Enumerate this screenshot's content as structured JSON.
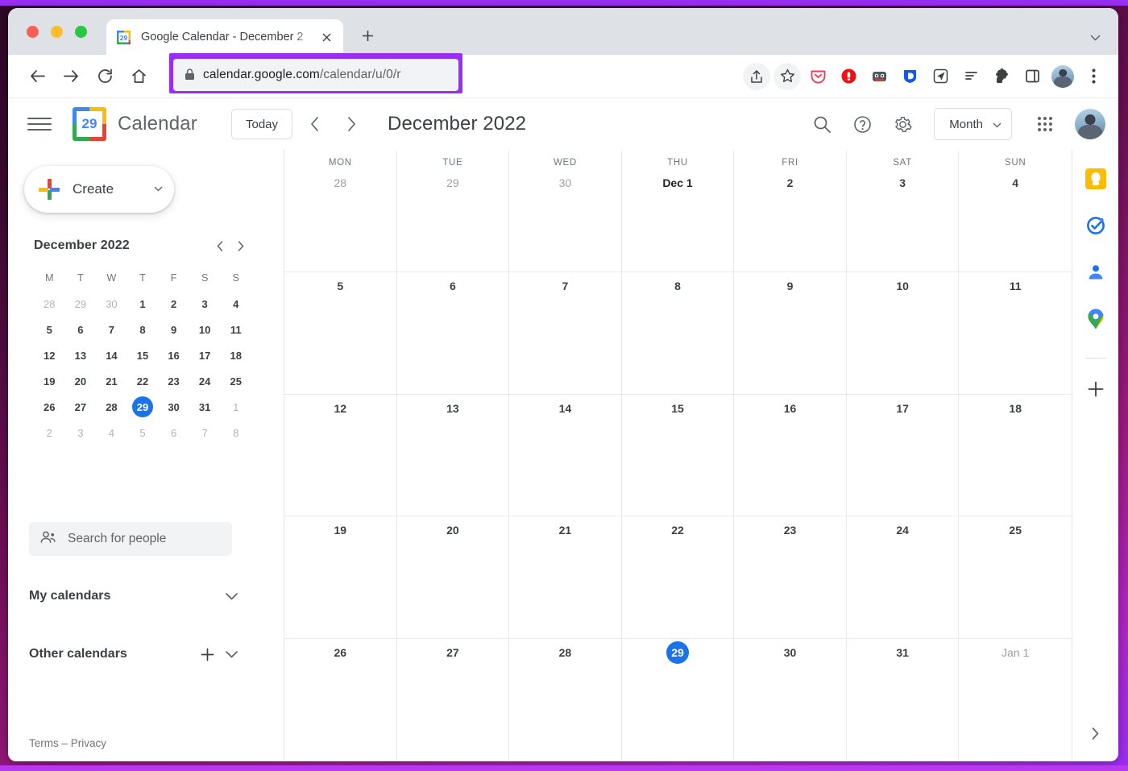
{
  "browser": {
    "tab": {
      "title": "Google Calendar - December 2",
      "favicon_label": "29",
      "close_icon": "close-icon"
    },
    "new_tab_label": "+",
    "tabstrip_chevron": "⌄",
    "omnibox": {
      "domain": "calendar.google.com",
      "path": "/calendar/u/0/r",
      "lock_icon": "lock-icon",
      "highlight_color": "#9b2ef5"
    },
    "nav": {
      "back": "back-arrow",
      "forward": "forward-arrow",
      "reload": "reload-icon",
      "home": "home-icon"
    },
    "extensions": [
      "share-icon",
      "bookmark-star-icon",
      "pocket-extension-icon",
      "adblock-extension-icon",
      "avatar-extension-icon",
      "dashlane-extension-icon",
      "paperplane-extension-icon",
      "reading-list-icon",
      "puzzle-extensions-icon",
      "side-panel-icon",
      "profile-avatar",
      "chrome-menu-icon"
    ]
  },
  "app": {
    "menu_label": "main-menu",
    "logo_label": "29",
    "title": "Calendar",
    "today_label": "Today",
    "prev_label": "‹",
    "next_label": "›",
    "period": "December 2022",
    "search_label": "search-icon",
    "help_label": "help-icon",
    "settings_label": "settings-icon",
    "view_label": "Month",
    "view_caret": "▾",
    "apps_label": "google-apps-grid",
    "avatar_label": "account-avatar"
  },
  "sidebar": {
    "create_label": "Create",
    "create_caret": "▾",
    "mini_calendar": {
      "title": "December 2022",
      "prev": "‹",
      "next": "›",
      "dow": [
        "M",
        "T",
        "W",
        "T",
        "F",
        "S",
        "S"
      ],
      "weeks": [
        [
          {
            "d": "28",
            "m": true
          },
          {
            "d": "29",
            "m": true
          },
          {
            "d": "30",
            "m": true
          },
          {
            "d": "1"
          },
          {
            "d": "2"
          },
          {
            "d": "3"
          },
          {
            "d": "4"
          }
        ],
        [
          {
            "d": "5"
          },
          {
            "d": "6"
          },
          {
            "d": "7"
          },
          {
            "d": "8"
          },
          {
            "d": "9"
          },
          {
            "d": "10"
          },
          {
            "d": "11"
          }
        ],
        [
          {
            "d": "12"
          },
          {
            "d": "13"
          },
          {
            "d": "14"
          },
          {
            "d": "15"
          },
          {
            "d": "16"
          },
          {
            "d": "17"
          },
          {
            "d": "18"
          }
        ],
        [
          {
            "d": "19"
          },
          {
            "d": "20"
          },
          {
            "d": "21"
          },
          {
            "d": "22"
          },
          {
            "d": "23"
          },
          {
            "d": "24"
          },
          {
            "d": "25"
          }
        ],
        [
          {
            "d": "26"
          },
          {
            "d": "27"
          },
          {
            "d": "28"
          },
          {
            "d": "29",
            "sel": true
          },
          {
            "d": "30"
          },
          {
            "d": "31"
          },
          {
            "d": "1",
            "m": true
          }
        ],
        [
          {
            "d": "2",
            "m": true
          },
          {
            "d": "3",
            "m": true
          },
          {
            "d": "4",
            "m": true
          },
          {
            "d": "5",
            "m": true
          },
          {
            "d": "6",
            "m": true
          },
          {
            "d": "7",
            "m": true
          },
          {
            "d": "8",
            "m": true
          }
        ]
      ],
      "selected_color": "#1a73e8"
    },
    "people_search_placeholder": "Search for people",
    "my_calendars_label": "My calendars",
    "other_calendars_label": "Other calendars",
    "add_calendar_label": "+",
    "expand_caret": "⌄",
    "terms_label": "Terms – Privacy"
  },
  "month_view": {
    "dow": [
      "MON",
      "TUE",
      "WED",
      "THU",
      "FRI",
      "SAT",
      "SUN"
    ],
    "weeks": [
      [
        {
          "d": "28",
          "m": true
        },
        {
          "d": "29",
          "m": true
        },
        {
          "d": "30",
          "m": true
        },
        {
          "d": "Dec 1",
          "first": true
        },
        {
          "d": "2"
        },
        {
          "d": "3"
        },
        {
          "d": "4"
        }
      ],
      [
        {
          "d": "5"
        },
        {
          "d": "6"
        },
        {
          "d": "7"
        },
        {
          "d": "8"
        },
        {
          "d": "9"
        },
        {
          "d": "10"
        },
        {
          "d": "11"
        }
      ],
      [
        {
          "d": "12"
        },
        {
          "d": "13"
        },
        {
          "d": "14"
        },
        {
          "d": "15"
        },
        {
          "d": "16"
        },
        {
          "d": "17"
        },
        {
          "d": "18"
        }
      ],
      [
        {
          "d": "19"
        },
        {
          "d": "20"
        },
        {
          "d": "21"
        },
        {
          "d": "22"
        },
        {
          "d": "23"
        },
        {
          "d": "24"
        },
        {
          "d": "25"
        }
      ],
      [
        {
          "d": "26"
        },
        {
          "d": "27"
        },
        {
          "d": "28"
        },
        {
          "d": "29",
          "today": true
        },
        {
          "d": "30"
        },
        {
          "d": "31"
        },
        {
          "d": "Jan 1",
          "m": true
        }
      ]
    ],
    "today_color": "#1a73e8"
  },
  "side_panel": {
    "items": [
      "keep-icon",
      "tasks-icon",
      "contacts-icon",
      "maps-icon"
    ],
    "add_label": "+",
    "expand_label": "›"
  }
}
